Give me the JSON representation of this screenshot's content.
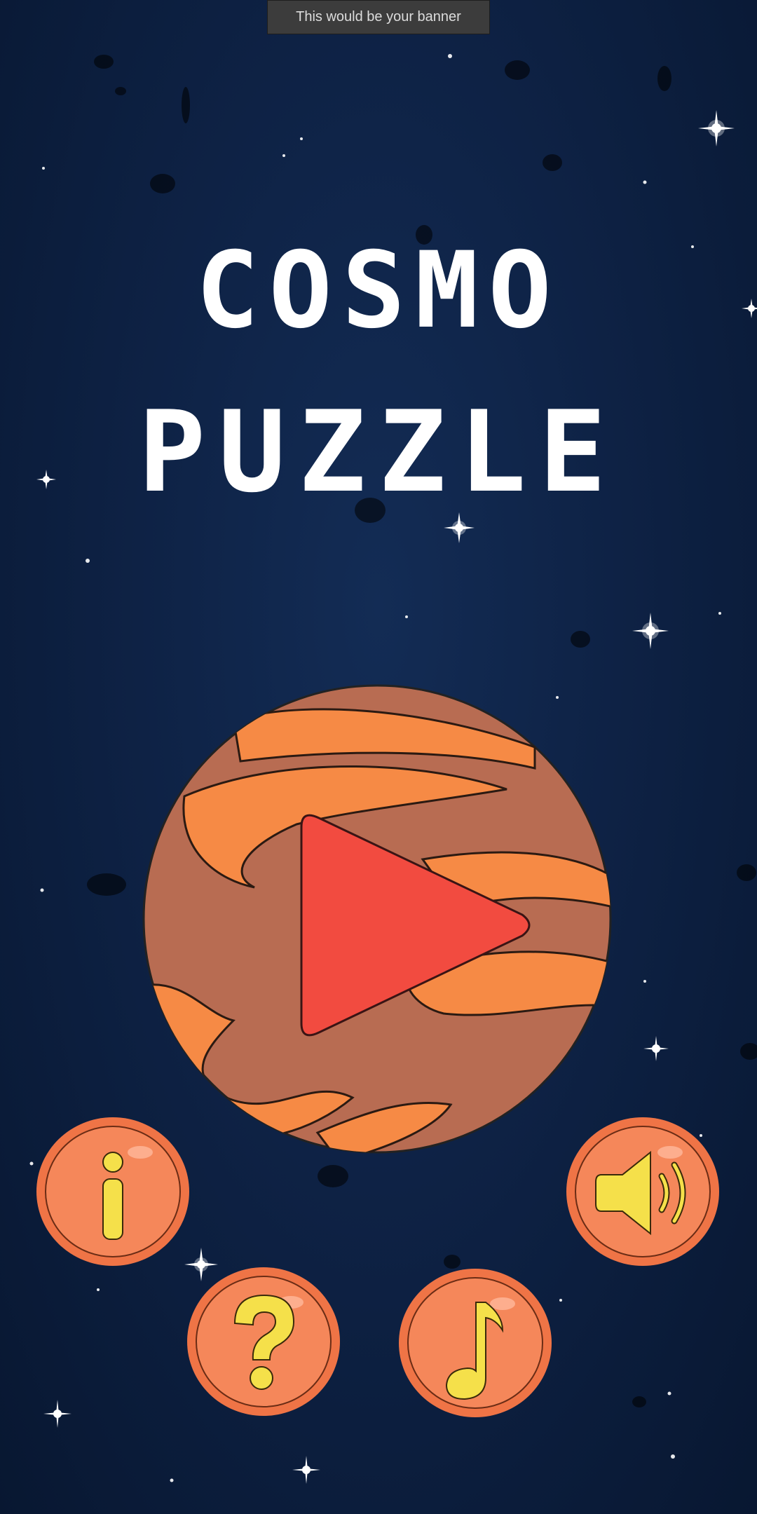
{
  "banner": {
    "text": "This would be your banner"
  },
  "title": {
    "line1": "COSMO",
    "line2": "PUZZLE"
  },
  "colors": {
    "background": "#0e2245",
    "planet": "#b86c52",
    "planet_swirl": "#f68a45",
    "play": "#f24b40",
    "button_ring": "#ef7446",
    "button_fill": "#f5875a",
    "icon_yellow": "#f5e04a"
  },
  "icons": {
    "play": "play-icon",
    "info": "info-icon",
    "sound": "speaker-icon",
    "help": "question-mark-icon",
    "music": "music-note-icon"
  }
}
